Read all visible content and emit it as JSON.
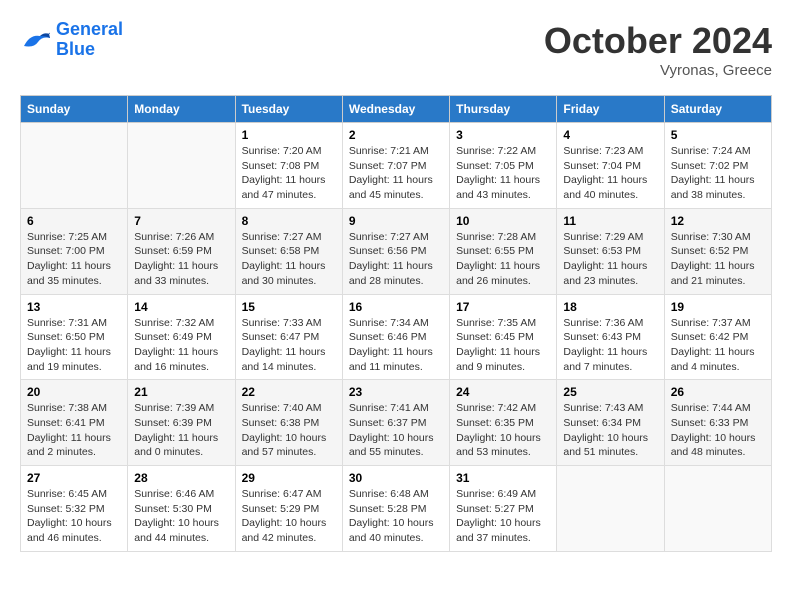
{
  "header": {
    "logo_line1": "General",
    "logo_line2": "Blue",
    "month": "October 2024",
    "location": "Vyronas, Greece"
  },
  "days_of_week": [
    "Sunday",
    "Monday",
    "Tuesday",
    "Wednesday",
    "Thursday",
    "Friday",
    "Saturday"
  ],
  "weeks": [
    [
      {
        "day": null,
        "info": null
      },
      {
        "day": null,
        "info": null
      },
      {
        "day": "1",
        "info": "Sunrise: 7:20 AM\nSunset: 7:08 PM\nDaylight: 11 hours and 47 minutes."
      },
      {
        "day": "2",
        "info": "Sunrise: 7:21 AM\nSunset: 7:07 PM\nDaylight: 11 hours and 45 minutes."
      },
      {
        "day": "3",
        "info": "Sunrise: 7:22 AM\nSunset: 7:05 PM\nDaylight: 11 hours and 43 minutes."
      },
      {
        "day": "4",
        "info": "Sunrise: 7:23 AM\nSunset: 7:04 PM\nDaylight: 11 hours and 40 minutes."
      },
      {
        "day": "5",
        "info": "Sunrise: 7:24 AM\nSunset: 7:02 PM\nDaylight: 11 hours and 38 minutes."
      }
    ],
    [
      {
        "day": "6",
        "info": "Sunrise: 7:25 AM\nSunset: 7:00 PM\nDaylight: 11 hours and 35 minutes."
      },
      {
        "day": "7",
        "info": "Sunrise: 7:26 AM\nSunset: 6:59 PM\nDaylight: 11 hours and 33 minutes."
      },
      {
        "day": "8",
        "info": "Sunrise: 7:27 AM\nSunset: 6:58 PM\nDaylight: 11 hours and 30 minutes."
      },
      {
        "day": "9",
        "info": "Sunrise: 7:27 AM\nSunset: 6:56 PM\nDaylight: 11 hours and 28 minutes."
      },
      {
        "day": "10",
        "info": "Sunrise: 7:28 AM\nSunset: 6:55 PM\nDaylight: 11 hours and 26 minutes."
      },
      {
        "day": "11",
        "info": "Sunrise: 7:29 AM\nSunset: 6:53 PM\nDaylight: 11 hours and 23 minutes."
      },
      {
        "day": "12",
        "info": "Sunrise: 7:30 AM\nSunset: 6:52 PM\nDaylight: 11 hours and 21 minutes."
      }
    ],
    [
      {
        "day": "13",
        "info": "Sunrise: 7:31 AM\nSunset: 6:50 PM\nDaylight: 11 hours and 19 minutes."
      },
      {
        "day": "14",
        "info": "Sunrise: 7:32 AM\nSunset: 6:49 PM\nDaylight: 11 hours and 16 minutes."
      },
      {
        "day": "15",
        "info": "Sunrise: 7:33 AM\nSunset: 6:47 PM\nDaylight: 11 hours and 14 minutes."
      },
      {
        "day": "16",
        "info": "Sunrise: 7:34 AM\nSunset: 6:46 PM\nDaylight: 11 hours and 11 minutes."
      },
      {
        "day": "17",
        "info": "Sunrise: 7:35 AM\nSunset: 6:45 PM\nDaylight: 11 hours and 9 minutes."
      },
      {
        "day": "18",
        "info": "Sunrise: 7:36 AM\nSunset: 6:43 PM\nDaylight: 11 hours and 7 minutes."
      },
      {
        "day": "19",
        "info": "Sunrise: 7:37 AM\nSunset: 6:42 PM\nDaylight: 11 hours and 4 minutes."
      }
    ],
    [
      {
        "day": "20",
        "info": "Sunrise: 7:38 AM\nSunset: 6:41 PM\nDaylight: 11 hours and 2 minutes."
      },
      {
        "day": "21",
        "info": "Sunrise: 7:39 AM\nSunset: 6:39 PM\nDaylight: 11 hours and 0 minutes."
      },
      {
        "day": "22",
        "info": "Sunrise: 7:40 AM\nSunset: 6:38 PM\nDaylight: 10 hours and 57 minutes."
      },
      {
        "day": "23",
        "info": "Sunrise: 7:41 AM\nSunset: 6:37 PM\nDaylight: 10 hours and 55 minutes."
      },
      {
        "day": "24",
        "info": "Sunrise: 7:42 AM\nSunset: 6:35 PM\nDaylight: 10 hours and 53 minutes."
      },
      {
        "day": "25",
        "info": "Sunrise: 7:43 AM\nSunset: 6:34 PM\nDaylight: 10 hours and 51 minutes."
      },
      {
        "day": "26",
        "info": "Sunrise: 7:44 AM\nSunset: 6:33 PM\nDaylight: 10 hours and 48 minutes."
      }
    ],
    [
      {
        "day": "27",
        "info": "Sunrise: 6:45 AM\nSunset: 5:32 PM\nDaylight: 10 hours and 46 minutes."
      },
      {
        "day": "28",
        "info": "Sunrise: 6:46 AM\nSunset: 5:30 PM\nDaylight: 10 hours and 44 minutes."
      },
      {
        "day": "29",
        "info": "Sunrise: 6:47 AM\nSunset: 5:29 PM\nDaylight: 10 hours and 42 minutes."
      },
      {
        "day": "30",
        "info": "Sunrise: 6:48 AM\nSunset: 5:28 PM\nDaylight: 10 hours and 40 minutes."
      },
      {
        "day": "31",
        "info": "Sunrise: 6:49 AM\nSunset: 5:27 PM\nDaylight: 10 hours and 37 minutes."
      },
      {
        "day": null,
        "info": null
      },
      {
        "day": null,
        "info": null
      }
    ]
  ]
}
